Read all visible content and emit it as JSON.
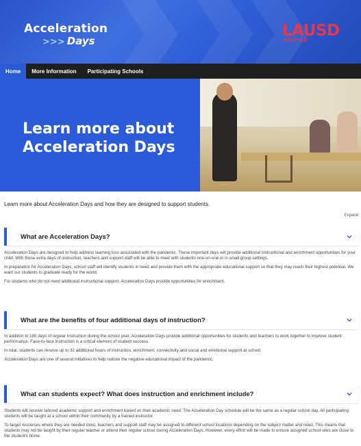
{
  "header": {
    "logo_line1": "Acceleration",
    "logo_line2": "Days",
    "logo_arrows": ">>>",
    "district_name": "LAUSD",
    "district_sub": "UNIFIED"
  },
  "nav": {
    "items": [
      {
        "label": "Home"
      },
      {
        "label": "More Information"
      },
      {
        "label": "Participating Schools"
      }
    ]
  },
  "hero": {
    "title": "Learn more about Acceleration Days"
  },
  "intro": "Learn more about Acceleration Days and how they are designed to support students.",
  "expand_label": "Expand",
  "sections": [
    {
      "title": "What are Acceleration Days?",
      "paragraphs": [
        "Acceleration Days are designed to help address learning loss associated with the pandemic. These important days will provide additional instructional and enrichment opportunities for your child. With these extra days of instruction, teachers and support staff will be able to meet with students one-on-one or in small group settings.",
        "In preparation for Acceleration Days, school staff will identify students in need and provide them with the appropriate educational support so that they may reach their highest potential. We want our students to graduate ready for the world.",
        "For students who do not need additional instructional support, Acceleration Days provide opportunities for enrichment."
      ]
    },
    {
      "title": "What are the benefits of four additional days of instruction?",
      "paragraphs": [
        "In addition to 180 days of regular instruction during the school year, Acceleration Days provide additional opportunities for students and teachers to work together to improve student performance. Face-to-face instruction is a critical element of student success.",
        "In total, students can receive up to 32 additional hours of instruction, enrichment, connectivity and social and emotional support at school.",
        "Acceleration Days are one of several initiatives to help reduce the negative educational impact of the pandemic."
      ]
    },
    {
      "title": "What can students expect? What does instruction and enrichment include?",
      "paragraphs": [
        "Students will receive tailored academic support and enrichment based on their academic need. The Acceleration Day schedule will be the same as a regular school day. All participating students will be taught at a school within their community by a trained instructor.",
        "To target resources where they are needed most, teachers and support staff may be assigned to different school locations depending on the subject matter and need. This means that students may not be taught by their regular teacher or attend their regular school during Acceleration Days. However, every effort will be made to ensure assigned school sites are close to the student's home."
      ]
    }
  ],
  "colors": {
    "brand_blue": "#2a5bd6",
    "nav_dark": "#1f1f1f",
    "district_red": "#e8374a"
  }
}
